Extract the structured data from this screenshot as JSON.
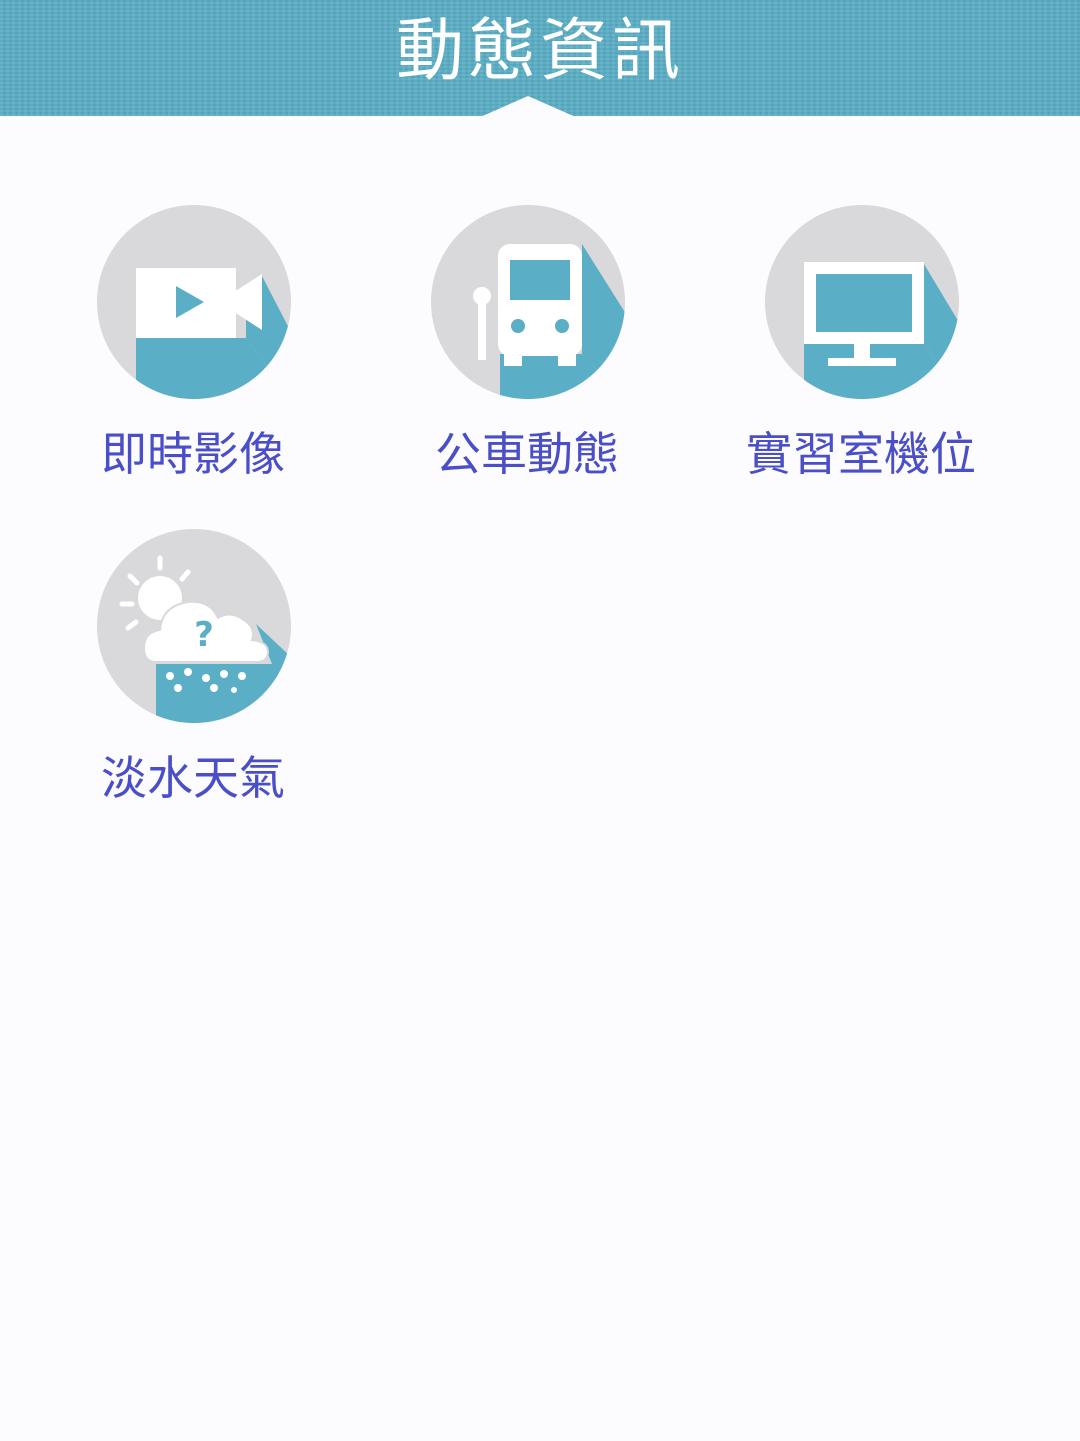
{
  "header": {
    "title": "動態資訊",
    "color": "#5aaec6"
  },
  "grid": {
    "items": [
      {
        "label": "即時影像",
        "icon": "video-camera-icon"
      },
      {
        "label": "公車動態",
        "icon": "bus-icon"
      },
      {
        "label": "實習室機位",
        "icon": "monitor-icon"
      },
      {
        "label": "淡水天氣",
        "icon": "weather-icon"
      }
    ]
  },
  "colors": {
    "icon_circle": "#d9d9db",
    "icon_shadow": "#5aaec6",
    "label": "#4a4fc9",
    "background": "#fcfbfe"
  }
}
